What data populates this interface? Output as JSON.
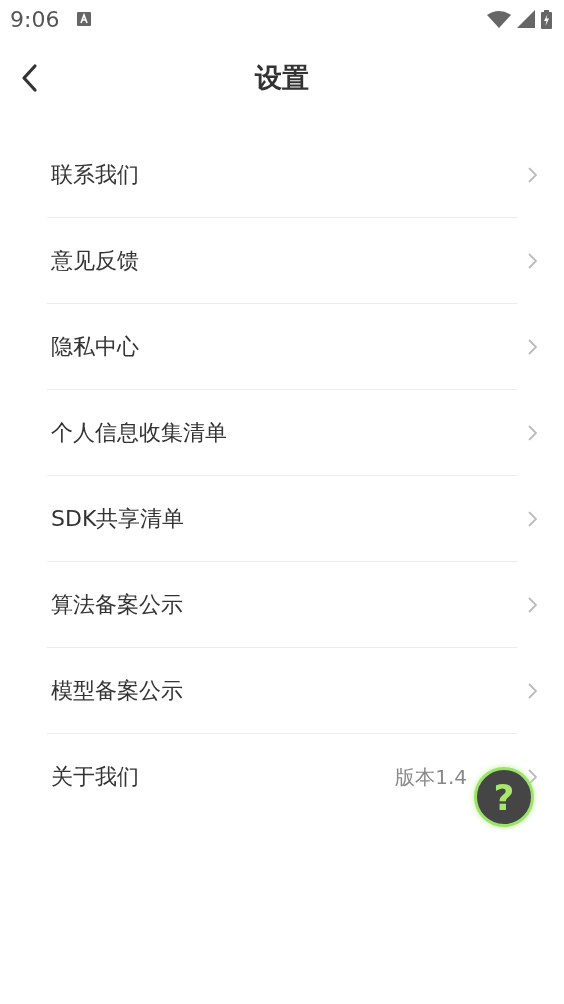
{
  "status_bar": {
    "time": "9:06"
  },
  "header": {
    "title": "设置"
  },
  "items": [
    {
      "label": "联系我们"
    },
    {
      "label": "意见反馈"
    },
    {
      "label": "隐私中心"
    },
    {
      "label": "个人信息收集清单"
    },
    {
      "label": "SDK共享清单"
    },
    {
      "label": "算法备案公示"
    },
    {
      "label": "模型备案公示"
    },
    {
      "label": "关于我们",
      "value": "版本1.4"
    }
  ],
  "help_button": {
    "label": "?"
  }
}
